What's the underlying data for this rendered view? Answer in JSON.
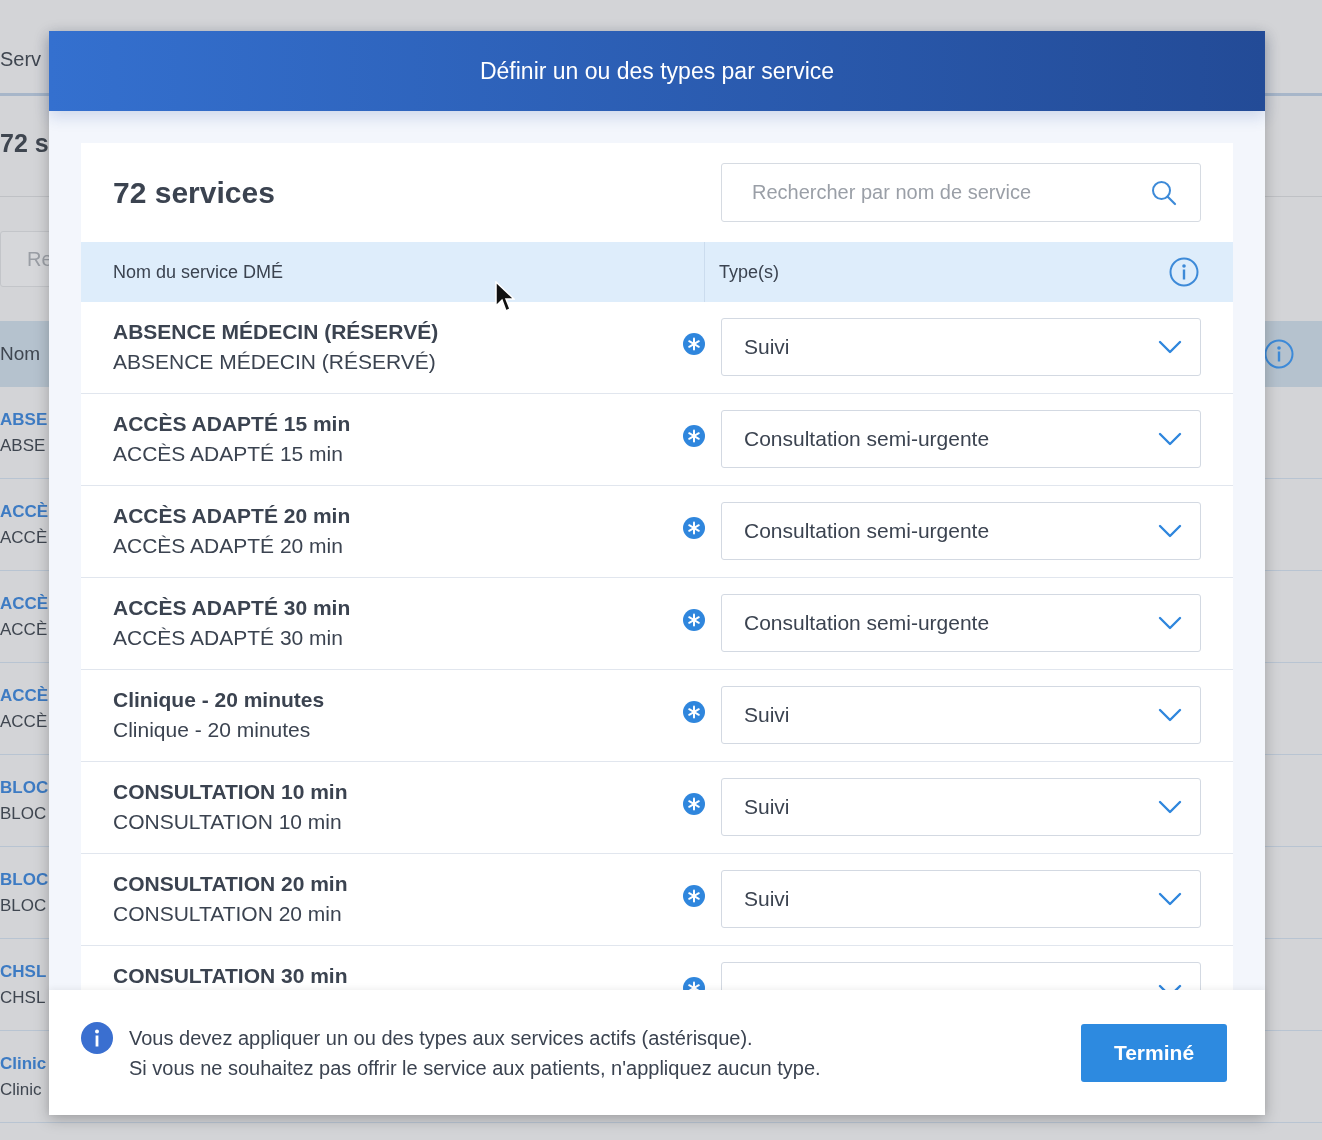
{
  "background_page": {
    "tab": "Serv",
    "count": "72 s",
    "search": {
      "placeholder": "Re"
    },
    "table_header": "Nom",
    "rows": [
      {
        "name": "ABSE",
        "subname": "ABSE"
      },
      {
        "name": "ACCÈ",
        "subname": "ACCÈ"
      },
      {
        "name": "ACCÈ",
        "subname": "ACCÈ"
      },
      {
        "name": "ACCÈ",
        "subname": "ACCÈ"
      },
      {
        "name": "BLOC",
        "subname": "BLOC"
      },
      {
        "name": "BLOC",
        "subname": "BLOC"
      },
      {
        "name": "CHSL",
        "subname": "CHSL"
      },
      {
        "name": "Clinic",
        "subname": "Clinic"
      }
    ]
  },
  "dialog": {
    "title": "Définir un ou des types par service",
    "count": "72 services",
    "search": {
      "placeholder": "Rechercher par nom de service"
    },
    "columns": [
      "Nom du service DMÉ",
      "Type(s)"
    ],
    "rows": [
      {
        "name": "ABSENCE MÉDECIN (RÉSERVÉ)",
        "subname": "ABSENCE MÉDECIN (RÉSERVÉ)",
        "active": true,
        "type": "Suivi"
      },
      {
        "name": "ACCÈS ADAPTÉ 15 min",
        "subname": "ACCÈS ADAPTÉ 15 min",
        "active": true,
        "type": "Consultation semi-urgente"
      },
      {
        "name": "ACCÈS ADAPTÉ 20 min",
        "subname": "ACCÈS ADAPTÉ 20 min",
        "active": true,
        "type": "Consultation semi-urgente"
      },
      {
        "name": "ACCÈS ADAPTÉ 30 min",
        "subname": "ACCÈS ADAPTÉ 30 min",
        "active": true,
        "type": "Consultation semi-urgente"
      },
      {
        "name": "Clinique - 20 minutes",
        "subname": "Clinique - 20 minutes",
        "active": true,
        "type": "Suivi"
      },
      {
        "name": "CONSULTATION 10 min",
        "subname": "CONSULTATION 10 min",
        "active": true,
        "type": "Suivi"
      },
      {
        "name": "CONSULTATION 20 min",
        "subname": "CONSULTATION 20 min",
        "active": true,
        "type": "Suivi"
      },
      {
        "name": "CONSULTATION 30 min",
        "active": true
      }
    ],
    "footer": {
      "message": [
        "Vous devez appliquer un ou des types aux services actifs (astérisque).",
        "Si vous ne souhaitez pas offrir le service aux patients, n'appliquez aucun type."
      ],
      "button": "Terminé"
    }
  }
}
